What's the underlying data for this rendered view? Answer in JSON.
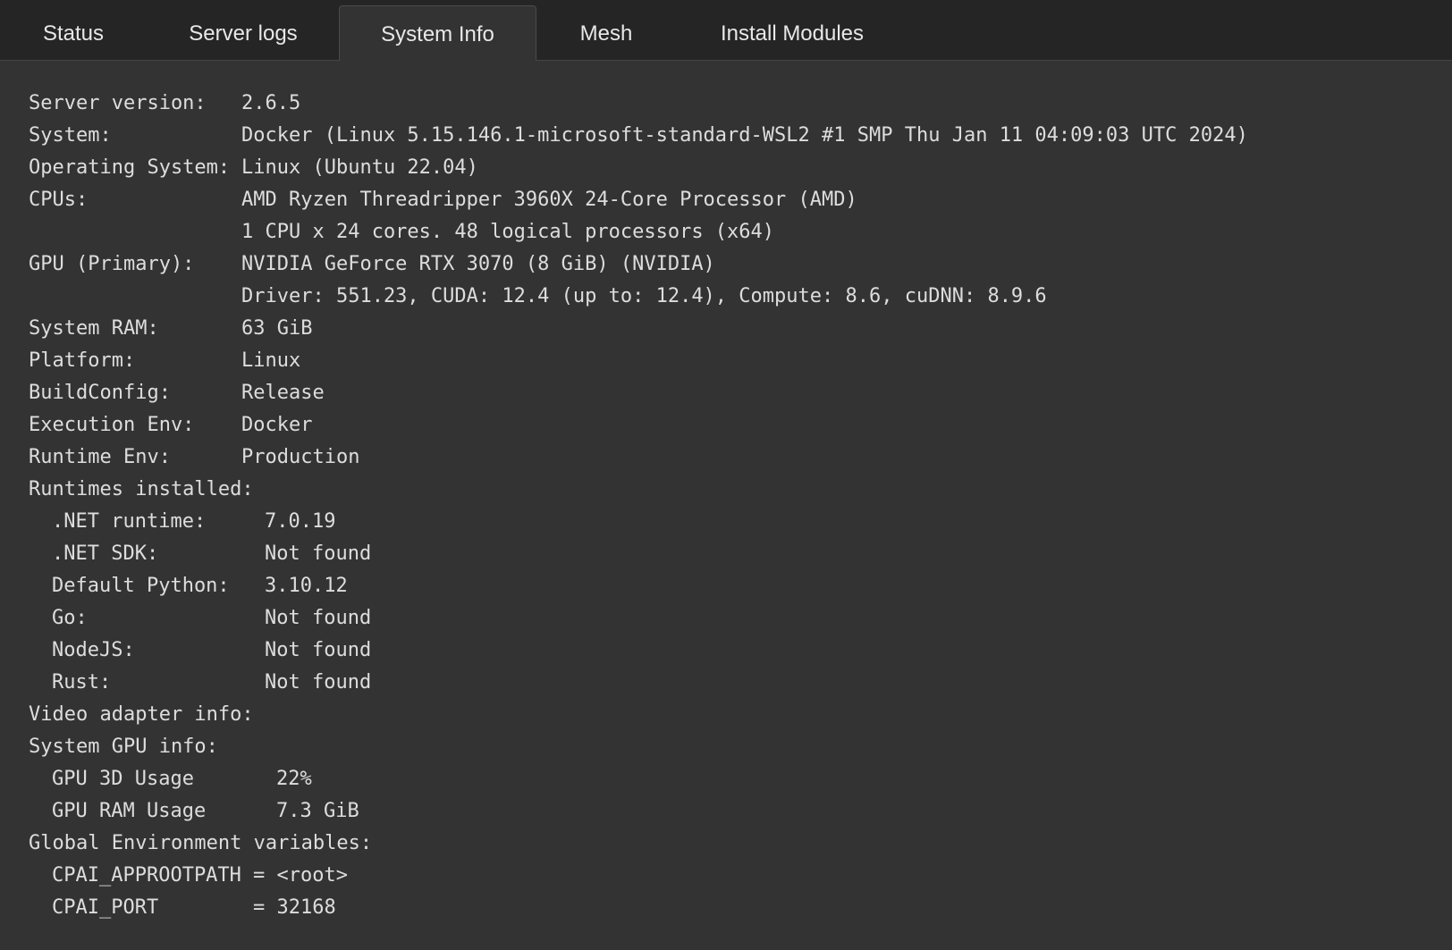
{
  "tabs": [
    {
      "label": "Status"
    },
    {
      "label": "Server logs"
    },
    {
      "label": "System Info"
    },
    {
      "label": "Mesh"
    },
    {
      "label": "Install Modules"
    }
  ],
  "active_tab": "System Info",
  "system": {
    "server_version": {
      "label": "Server version:",
      "value": "2.6.5"
    },
    "system": {
      "label": "System:",
      "value": "Docker (Linux 5.15.146.1-microsoft-standard-WSL2 #1 SMP Thu Jan 11 04:09:03 UTC 2024)"
    },
    "os": {
      "label": "Operating System:",
      "value": "Linux (Ubuntu 22.04)"
    },
    "cpus": {
      "label": "CPUs:",
      "value": "AMD Ryzen Threadripper 3960X 24-Core Processor (AMD)",
      "value2": "1 CPU x 24 cores. 48 logical processors (x64)"
    },
    "gpu": {
      "label": "GPU (Primary):",
      "value": "NVIDIA GeForce RTX 3070 (8 GiB) (NVIDIA)",
      "value2": "Driver: 551.23, CUDA: 12.4 (up to: 12.4), Compute: 8.6, cuDNN: 8.9.6"
    },
    "ram": {
      "label": "System RAM:",
      "value": "63 GiB"
    },
    "platform": {
      "label": "Platform:",
      "value": "Linux"
    },
    "build_config": {
      "label": "BuildConfig:",
      "value": "Release"
    },
    "execution_env": {
      "label": "Execution Env:",
      "value": "Docker"
    },
    "runtime_env": {
      "label": "Runtime Env:",
      "value": "Production"
    }
  },
  "runtimes": {
    "header": "Runtimes installed:",
    "items": [
      {
        "label": ".NET runtime:",
        "value": "7.0.19"
      },
      {
        "label": ".NET SDK:",
        "value": "Not found"
      },
      {
        "label": "Default Python:",
        "value": "3.10.12"
      },
      {
        "label": "Go:",
        "value": "Not found"
      },
      {
        "label": "NodeJS:",
        "value": "Not found"
      },
      {
        "label": "Rust:",
        "value": "Not found"
      }
    ]
  },
  "video_adapter": {
    "header": "Video adapter info:"
  },
  "gpu_info": {
    "header": "System GPU info:",
    "items": [
      {
        "label": "GPU 3D Usage",
        "value": "22%"
      },
      {
        "label": "GPU RAM Usage",
        "value": "7.3 GiB"
      }
    ]
  },
  "env_vars": {
    "header": "Global Environment variables:",
    "items": [
      {
        "label": "CPAI_APPROOTPATH",
        "value": "= <root>"
      },
      {
        "label": "CPAI_PORT",
        "value": "= 32168"
      }
    ]
  }
}
